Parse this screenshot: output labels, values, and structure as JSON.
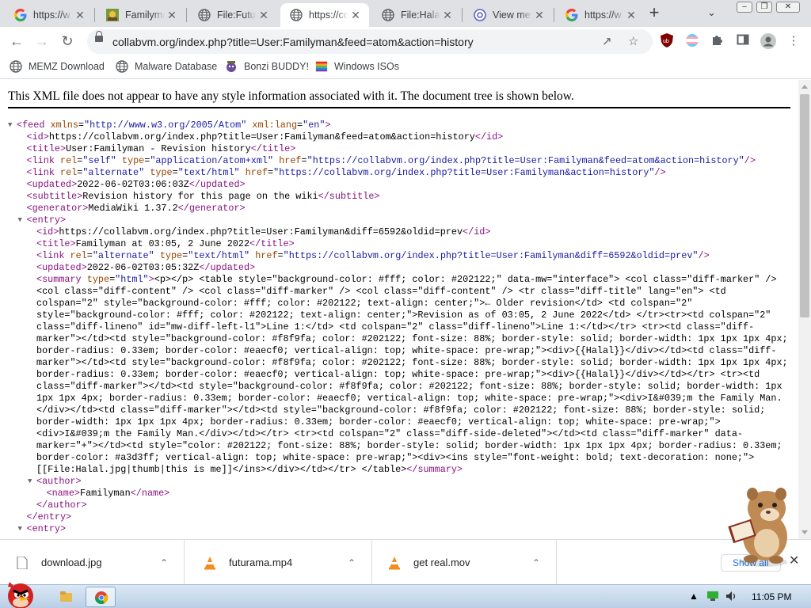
{
  "tabs": [
    {
      "title": "https://w",
      "icon": "google-g-icon",
      "active": false
    },
    {
      "title": "Familyma",
      "icon": "wiki-logo-icon",
      "active": false
    },
    {
      "title": "File:Futur",
      "icon": "globe-icon",
      "active": false
    },
    {
      "title": "https://co",
      "icon": "globe-icon",
      "active": true
    },
    {
      "title": "File:Halal",
      "icon": "globe-icon",
      "active": false
    },
    {
      "title": "View mes",
      "icon": "at-sign-icon",
      "active": false
    },
    {
      "title": "https://w",
      "icon": "google-g-icon",
      "active": false
    }
  ],
  "toolbar": {
    "url": "collabvm.org/index.php?title=User:Familyman&feed=atom&action=history"
  },
  "bookmarks": [
    {
      "label": "MEMZ Download",
      "icon": "globe-icon"
    },
    {
      "label": "Malware Database",
      "icon": "globe-icon"
    },
    {
      "label": "Bonzi BUDDY!",
      "icon": "bonzi-icon"
    },
    {
      "label": "Windows ISOs",
      "icon": "windows-flag-icon"
    }
  ],
  "page": {
    "notice": "This XML file does not appear to have any style information associated with it. The document tree is shown below."
  },
  "xml_lines": [
    {
      "indent": 0,
      "toggle": "▼",
      "html": "<span class='tg'>&lt;feed</span> <span class='an'>xmlns</span>=<span class='av'>\"http://www.w3.org/2005/Atom\"</span> <span class='an'>xml:lang</span>=<span class='av'>\"en\"</span><span class='tg'>&gt;</span>"
    },
    {
      "indent": 1,
      "toggle": "",
      "html": "<span class='tg'>&lt;id&gt;</span>https://collabvm.org/index.php?title=User:Familyman&amp;feed=atom&amp;action=history<span class='tg'>&lt;/id&gt;</span>"
    },
    {
      "indent": 1,
      "toggle": "",
      "html": "<span class='tg'>&lt;title&gt;</span>User:Familyman - Revision history<span class='tg'>&lt;/title&gt;</span>"
    },
    {
      "indent": 1,
      "toggle": "",
      "html": "<span class='tg'>&lt;link</span> <span class='an'>rel</span>=<span class='av'>\"self\"</span> <span class='an'>type</span>=<span class='av'>\"application/atom+xml\"</span> <span class='an'>href</span>=<span class='av'>\"https://collabvm.org/index.php?title=User:Familyman&amp;feed=atom&amp;action=history\"</span><span class='tg'>/&gt;</span>"
    },
    {
      "indent": 1,
      "toggle": "",
      "html": "<span class='tg'>&lt;link</span> <span class='an'>rel</span>=<span class='av'>\"alternate\"</span> <span class='an'>type</span>=<span class='av'>\"text/html\"</span> <span class='an'>href</span>=<span class='av'>\"https://collabvm.org/index.php?title=User:Familyman&amp;action=history\"</span><span class='tg'>/&gt;</span>"
    },
    {
      "indent": 1,
      "toggle": "",
      "html": "<span class='tg'>&lt;updated&gt;</span>2022-06-02T03:06:03Z<span class='tg'>&lt;/updated&gt;</span>"
    },
    {
      "indent": 1,
      "toggle": "",
      "html": "<span class='tg'>&lt;subtitle&gt;</span>Revision history for this page on the wiki<span class='tg'>&lt;/subtitle&gt;</span>"
    },
    {
      "indent": 1,
      "toggle": "",
      "html": "<span class='tg'>&lt;generator&gt;</span>MediaWiki 1.37.2<span class='tg'>&lt;/generator&gt;</span>"
    },
    {
      "indent": 1,
      "toggle": "▼",
      "html": "<span class='tg'>&lt;entry&gt;</span>"
    },
    {
      "indent": 2,
      "toggle": "",
      "html": "<span class='tg'>&lt;id&gt;</span>https://collabvm.org/index.php?title=User:Familyman&amp;diff=6592&amp;oldid=prev<span class='tg'>&lt;/id&gt;</span>"
    },
    {
      "indent": 2,
      "toggle": "",
      "html": "<span class='tg'>&lt;title&gt;</span>Familyman at 03:05, 2 June 2022<span class='tg'>&lt;/title&gt;</span>"
    },
    {
      "indent": 2,
      "toggle": "",
      "html": "<span class='tg'>&lt;link</span> <span class='an'>rel</span>=<span class='av'>\"alternate\"</span> <span class='an'>type</span>=<span class='av'>\"text/html\"</span> <span class='an'>href</span>=<span class='av'>\"https://collabvm.org/index.php?title=User:Familyman&amp;diff=6592&amp;oldid=prev\"</span><span class='tg'>/&gt;</span>"
    },
    {
      "indent": 2,
      "toggle": "",
      "html": "<span class='tg'>&lt;updated&gt;</span>2022-06-02T03:05:32Z<span class='tg'>&lt;/updated&gt;</span>"
    },
    {
      "indent": 2,
      "toggle": "",
      "html": "<span class='tg'>&lt;summary</span> <span class='an'>type</span>=<span class='av'>\"html\"</span><span class='tg'>&gt;</span>&lt;p&gt;&lt;/p&gt; &lt;table style=\"background-color: #fff; color: #202122;\" data-mw=\"interface\"&gt; &lt;col class=\"diff-marker\" /&gt;"
    },
    {
      "indent": 2,
      "toggle": "",
      "html": "&lt;col class=\"diff-content\" /&gt; &lt;col class=\"diff-marker\" /&gt; &lt;col class=\"diff-content\" /&gt; &lt;tr class=\"diff-title\" lang=\"en\"&gt; &lt;td"
    },
    {
      "indent": 2,
      "toggle": "",
      "html": "colspan=\"2\" style=\"background-color: #fff; color: #202122; text-align: center;\"&gt;← Older revision&lt;/td&gt; &lt;td colspan=\"2\""
    },
    {
      "indent": 2,
      "toggle": "",
      "html": "style=\"background-color: #fff; color: #202122; text-align: center;\"&gt;Revision as of 03:05, 2 June 2022&lt;/td&gt; &lt;/tr&gt;&lt;tr&gt;&lt;td colspan=\"2\""
    },
    {
      "indent": 2,
      "toggle": "",
      "html": "class=\"diff-lineno\" id=\"mw-diff-left-l1\"&gt;Line 1:&lt;/td&gt; &lt;td colspan=\"2\" class=\"diff-lineno\"&gt;Line 1:&lt;/td&gt;&lt;/tr&gt; &lt;tr&gt;&lt;td class=\"diff-"
    },
    {
      "indent": 2,
      "toggle": "",
      "html": "marker\"&gt;&lt;/td&gt;&lt;td style=\"background-color: #f8f9fa; color: #202122; font-size: 88%; border-style: solid; border-width: 1px 1px 1px 4px;"
    },
    {
      "indent": 2,
      "toggle": "",
      "html": "border-radius: 0.33em; border-color: #eaecf0; vertical-align: top; white-space: pre-wrap;\"&gt;&lt;div&gt;{{Halal}}&lt;/div&gt;&lt;/td&gt;&lt;td class=\"diff-"
    },
    {
      "indent": 2,
      "toggle": "",
      "html": "marker\"&gt;&lt;/td&gt;&lt;td style=\"background-color: #f8f9fa; color: #202122; font-size: 88%; border-style: solid; border-width: 1px 1px 1px 4px;"
    },
    {
      "indent": 2,
      "toggle": "",
      "html": "border-radius: 0.33em; border-color: #eaecf0; vertical-align: top; white-space: pre-wrap;\"&gt;&lt;div&gt;{{Halal}}&lt;/div&gt;&lt;/td&gt;&lt;/tr&gt; &lt;tr&gt;&lt;td"
    },
    {
      "indent": 2,
      "toggle": "",
      "html": "class=\"diff-marker\"&gt;&lt;/td&gt;&lt;td style=\"background-color: #f8f9fa; color: #202122; font-size: 88%; border-style: solid; border-width: 1px"
    },
    {
      "indent": 2,
      "toggle": "",
      "html": "1px 1px 4px; border-radius: 0.33em; border-color: #eaecf0; vertical-align: top; white-space: pre-wrap;\"&gt;&lt;div&gt;I&amp;#039;m the Family Man."
    },
    {
      "indent": 2,
      "toggle": "",
      "html": "&lt;/div&gt;&lt;/td&gt;&lt;td class=\"diff-marker\"&gt;&lt;/td&gt;&lt;td style=\"background-color: #f8f9fa; color: #202122; font-size: 88%; border-style: solid;"
    },
    {
      "indent": 2,
      "toggle": "",
      "html": "border-width: 1px 1px 1px 4px; border-radius: 0.33em; border-color: #eaecf0; vertical-align: top; white-space: pre-wrap;\"&gt;"
    },
    {
      "indent": 2,
      "toggle": "",
      "html": "&lt;div&gt;I&amp;#039;m the Family Man.&lt;/div&gt;&lt;/td&gt;&lt;/tr&gt; &lt;tr&gt;&lt;td colspan=\"2\" class=\"diff-side-deleted\"&gt;&lt;/td&gt;&lt;td class=\"diff-marker\" data-"
    },
    {
      "indent": 2,
      "toggle": "",
      "html": "marker=\"+\"&gt;&lt;/td&gt;&lt;td style=\"color: #202122; font-size: 88%; border-style: solid; border-width: 1px 1px 1px 4px; border-radius: 0.33em;"
    },
    {
      "indent": 2,
      "toggle": "",
      "html": "border-color: #a3d3ff; vertical-align: top; white-space: pre-wrap;\"&gt;&lt;div&gt;&lt;ins style=\"font-weight: bold; text-decoration: none;\"&gt;"
    },
    {
      "indent": 2,
      "toggle": "",
      "html": "[[File:Halal.jpg|thumb|this is me]]&lt;/ins&gt;&lt;/div&gt;&lt;/td&gt;&lt;/tr&gt; &lt;/table&gt;<span class='tg'>&lt;/summary&gt;</span>"
    },
    {
      "indent": 2,
      "toggle": "▼",
      "html": "<span class='tg'>&lt;author&gt;</span>"
    },
    {
      "indent": 3,
      "toggle": "",
      "html": "<span class='tg'>&lt;name&gt;</span>Familyman<span class='tg'>&lt;/name&gt;</span>"
    },
    {
      "indent": 2,
      "toggle": "",
      "html": "<span class='tg'>&lt;/author&gt;</span>"
    },
    {
      "indent": 1,
      "toggle": "",
      "html": "<span class='tg'>&lt;/entry&gt;</span>"
    },
    {
      "indent": 1,
      "toggle": "▼",
      "html": "<span class='tg'>&lt;entry&gt;</span>"
    }
  ],
  "downloads": [
    {
      "name": "download.jpg",
      "icon": "file-icon"
    },
    {
      "name": "futurama.mp4",
      "icon": "vlc-cone-icon"
    },
    {
      "name": "get real.mov",
      "icon": "vlc-cone-icon"
    }
  ],
  "downloads_bar": {
    "show_all": "Show all"
  },
  "taskbar": {
    "clock": "11:05 PM"
  }
}
